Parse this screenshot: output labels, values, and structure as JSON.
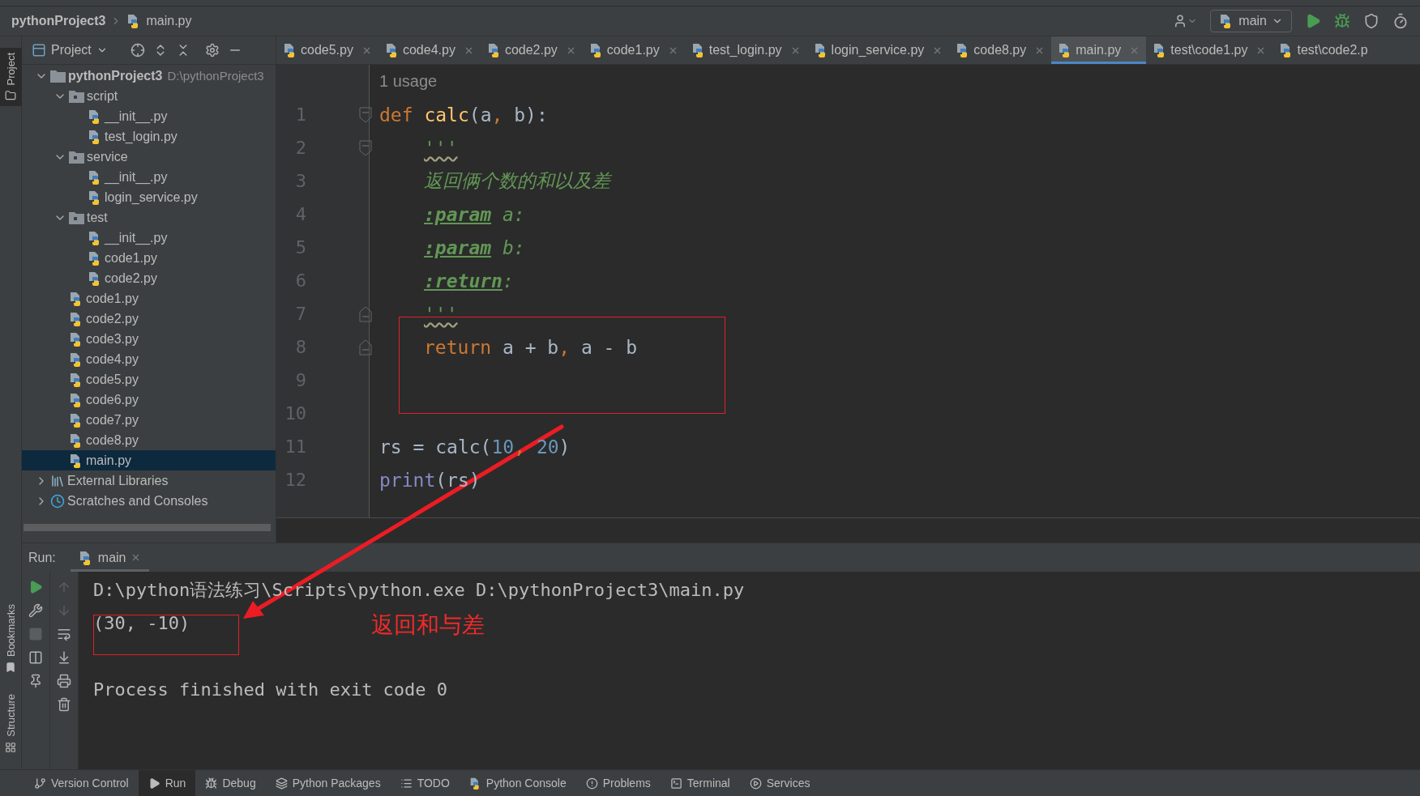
{
  "breadcrumb": [
    "pythonProject3",
    "main.py"
  ],
  "toolbar": {
    "run_config": "main"
  },
  "tool_strip_top": [
    {
      "label": "Project",
      "kind": "project",
      "selected": true
    }
  ],
  "tool_strip_bottom": [
    {
      "label": "Bookmarks",
      "kind": "bookmarks",
      "selected": false
    },
    {
      "label": "Structure",
      "kind": "structure",
      "selected": false
    }
  ],
  "project_panel": {
    "title": "Project",
    "tree": [
      {
        "label": "pythonProject3",
        "path": "D:\\pythonProject3",
        "kind": "root",
        "expanded": true,
        "selected": false,
        "children": [
          {
            "label": "script",
            "kind": "folder",
            "expanded": true,
            "selected": false,
            "children": [
              {
                "label": "__init__.py",
                "kind": "file",
                "selected": false
              },
              {
                "label": "test_login.py",
                "kind": "file",
                "selected": false
              }
            ]
          },
          {
            "label": "service",
            "kind": "folder",
            "expanded": true,
            "selected": false,
            "children": [
              {
                "label": "__init__.py",
                "kind": "file",
                "selected": false
              },
              {
                "label": "login_service.py",
                "kind": "file",
                "selected": false
              }
            ]
          },
          {
            "label": "test",
            "kind": "folder",
            "expanded": true,
            "selected": false,
            "children": [
              {
                "label": "__init__.py",
                "kind": "file",
                "selected": false
              },
              {
                "label": "code1.py",
                "kind": "file",
                "selected": false
              },
              {
                "label": "code2.py",
                "kind": "file",
                "selected": false
              }
            ]
          },
          {
            "label": "code1.py",
            "kind": "file",
            "selected": false
          },
          {
            "label": "code2.py",
            "kind": "file",
            "selected": false
          },
          {
            "label": "code3.py",
            "kind": "file",
            "selected": false
          },
          {
            "label": "code4.py",
            "kind": "file",
            "selected": false
          },
          {
            "label": "code5.py",
            "kind": "file",
            "selected": false
          },
          {
            "label": "code6.py",
            "kind": "file",
            "selected": false
          },
          {
            "label": "code7.py",
            "kind": "file",
            "selected": false
          },
          {
            "label": "code8.py",
            "kind": "file",
            "selected": false
          },
          {
            "label": "main.py",
            "kind": "file",
            "selected": true
          }
        ]
      },
      {
        "label": "External Libraries",
        "kind": "libraries",
        "expanded": false,
        "selected": false
      },
      {
        "label": "Scratches and Consoles",
        "kind": "scratches",
        "expanded": false,
        "selected": false
      }
    ]
  },
  "editor_tabs": [
    {
      "label": "code5.py",
      "selected": false
    },
    {
      "label": "code4.py",
      "selected": false
    },
    {
      "label": "code2.py",
      "selected": false
    },
    {
      "label": "code1.py",
      "selected": false
    },
    {
      "label": "test_login.py",
      "selected": false
    },
    {
      "label": "login_service.py",
      "selected": false
    },
    {
      "label": "code8.py",
      "selected": false
    },
    {
      "label": "main.py",
      "selected": true
    },
    {
      "label": "test\\code1.py",
      "selected": false
    },
    {
      "label": "test\\code2.p",
      "selected": false
    }
  ],
  "editor": {
    "usage_hint": "1 usage",
    "lines": [
      {
        "number": "1",
        "fold_start": true,
        "fold_end": false,
        "indented": false,
        "boxed": false,
        "tokens": [
          {
            "text": "def ",
            "kind": "keyword"
          },
          {
            "text": "calc",
            "kind": "function"
          },
          {
            "text": "(a",
            "kind": "plain"
          },
          {
            "text": ", ",
            "kind": "keyword"
          },
          {
            "text": "b):",
            "kind": "plain"
          }
        ]
      },
      {
        "number": "2",
        "fold_start": true,
        "fold_end": false,
        "indented": true,
        "boxed": false,
        "tokens": [
          {
            "text": "'''",
            "kind": "docquote"
          }
        ]
      },
      {
        "number": "3",
        "fold_start": false,
        "fold_end": false,
        "indented": true,
        "boxed": false,
        "tokens": [
          {
            "text": "返回俩个数的和以及差",
            "kind": "docstring"
          }
        ]
      },
      {
        "number": "4",
        "fold_start": false,
        "fold_end": false,
        "indented": true,
        "boxed": false,
        "tokens": [
          {
            "text": ":param",
            "kind": "doctag"
          },
          {
            "text": " a:",
            "kind": "docstring"
          }
        ]
      },
      {
        "number": "5",
        "fold_start": false,
        "fold_end": false,
        "indented": true,
        "boxed": false,
        "tokens": [
          {
            "text": ":param",
            "kind": "doctag"
          },
          {
            "text": " b:",
            "kind": "docstring"
          }
        ]
      },
      {
        "number": "6",
        "fold_start": false,
        "fold_end": false,
        "indented": true,
        "boxed": false,
        "tokens": [
          {
            "text": ":return",
            "kind": "doctag"
          },
          {
            "text": ":",
            "kind": "docstring"
          }
        ]
      },
      {
        "number": "7",
        "fold_start": false,
        "fold_end": true,
        "indented": true,
        "boxed": false,
        "tokens": [
          {
            "text": "'''",
            "kind": "docquote"
          }
        ]
      },
      {
        "number": "8",
        "fold_start": false,
        "fold_end": true,
        "indented": true,
        "boxed": true,
        "tokens": [
          {
            "text": "return ",
            "kind": "keyword"
          },
          {
            "text": "a + b",
            "kind": "plain"
          },
          {
            "text": ", ",
            "kind": "keyword"
          },
          {
            "text": "a - b",
            "kind": "plain"
          }
        ]
      },
      {
        "number": "9",
        "fold_start": false,
        "fold_end": false
      },
      {
        "number": "10",
        "fold_start": false,
        "fold_end": false
      },
      {
        "number": "11",
        "fold_start": false,
        "fold_end": false,
        "indented": false,
        "boxed": false,
        "tokens": [
          {
            "text": "rs = calc(",
            "kind": "plain"
          },
          {
            "text": "10",
            "kind": "number"
          },
          {
            "text": ", ",
            "kind": "keyword"
          },
          {
            "text": "20",
            "kind": "number"
          },
          {
            "text": ")",
            "kind": "plain"
          }
        ]
      },
      {
        "number": "12",
        "fold_start": false,
        "fold_end": false,
        "indented": false,
        "boxed": false,
        "tokens": [
          {
            "text": "print",
            "kind": "builtin"
          },
          {
            "text": "(rs)",
            "kind": "plain"
          }
        ]
      }
    ]
  },
  "run_panel": {
    "label": "Run:",
    "tab": "main",
    "output": [
      {
        "text": "D:\\python语法练习\\Scripts\\python.exe D:\\pythonProject3\\main.py",
        "kind": "command",
        "boxed": false
      },
      {
        "text": "(30, -10)",
        "kind": "result",
        "boxed": true
      },
      {
        "text": "Process finished with exit code 0",
        "kind": "status",
        "boxed": false
      }
    ]
  },
  "annotation": {
    "note": "返回和与差",
    "arrow": true
  },
  "status_bar": [
    {
      "label": "Version Control",
      "kind": "vcs",
      "selected": false
    },
    {
      "label": "Run",
      "kind": "run",
      "selected": true
    },
    {
      "label": "Debug",
      "kind": "debug",
      "selected": false
    },
    {
      "label": "Python Packages",
      "kind": "packages",
      "selected": false
    },
    {
      "label": "TODO",
      "kind": "todo",
      "selected": false
    },
    {
      "label": "Python Console",
      "kind": "console",
      "selected": false
    },
    {
      "label": "Problems",
      "kind": "problems",
      "selected": false
    },
    {
      "label": "Terminal",
      "kind": "terminal",
      "selected": false
    },
    {
      "label": "Services",
      "kind": "services",
      "selected": false
    }
  ]
}
